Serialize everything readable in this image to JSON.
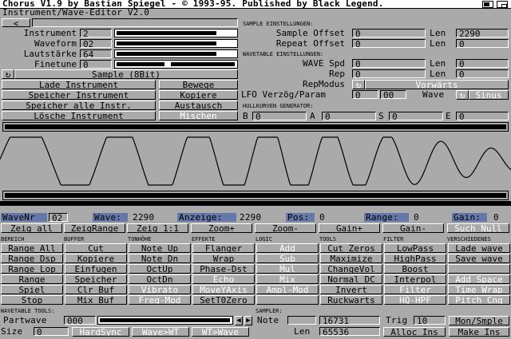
{
  "title": "Chorus V1.9 by Bastian Spiegel - © 1993-95. Published by Black Legend.",
  "editor_title": "Instrument/Wave-Editor V2.0",
  "top_left_btn": "<",
  "instrument_params": [
    {
      "label": "Instrument",
      "value": "2",
      "level": 0.98
    },
    {
      "label": "Waveform",
      "value": "02",
      "level": 0.98
    },
    {
      "label": "Lautstärke",
      "value": "64",
      "level": 0.98
    },
    {
      "label": "Finetune",
      "value": "0",
      "level": 0.48
    }
  ],
  "sample_btn": "Sample (8Bit)",
  "instr_buttons": [
    {
      "left": "Lade Instrument",
      "right": "Bewege"
    },
    {
      "left": "Speicher Instrument",
      "right": "Kopiere"
    },
    {
      "left": "Speicher alle Instr.",
      "right": "Austausch"
    },
    {
      "left": "Lösche Instrument",
      "right": "Mischen"
    }
  ],
  "sample_settings": {
    "header": "SAMPLE EINSTELLUNGEN:",
    "rows": [
      {
        "label": "Sample Offset",
        "value": "0",
        "len_label": "Len",
        "len": "2290"
      },
      {
        "label": "Repeat Offset",
        "value": "0",
        "len_label": "Len",
        "len": "0"
      }
    ]
  },
  "wavetable_settings": {
    "header": "WAVETABLE EINSTELLUNGEN:",
    "rows": [
      {
        "label": "WAVE Spd",
        "value": "0",
        "len_label": "Len",
        "len": "0"
      },
      {
        "label": "Rep",
        "value": "0",
        "len_label": "Len",
        "len": "0"
      }
    ],
    "repmodus_label": "RepModus",
    "repmodus_value": "Vorwärts",
    "lfo_label": "LFO Verzög/Param",
    "lfo_value": "0",
    "lfo_param": "00",
    "wave_label": "Wave",
    "wave_value": "Sinus"
  },
  "envelope": {
    "header": "HULLKURVEN GENERATOR:",
    "fields": [
      {
        "label": "B",
        "value": "0"
      },
      {
        "label": "A",
        "value": "0"
      },
      {
        "label": "S",
        "value": "0"
      },
      {
        "label": "E",
        "value": "0"
      }
    ]
  },
  "status": {
    "wavenr_label": "WaveNr",
    "wavenr": "02",
    "wave_label": "Wave:",
    "wave": "2290",
    "anzeige_label": "Anzeige:",
    "anzeige": "2290",
    "pos_label": "Pos:",
    "pos": "0",
    "range_label": "Range:",
    "range": "0",
    "gain_label": "Gain:",
    "gain": "0"
  },
  "zoom_row": [
    "Zeig all",
    "ZeigRange",
    "Zeig 1:1",
    "Zoom+",
    "Zoom-",
    "Gain+",
    "Gain-",
    "Such Null"
  ],
  "section_headers": [
    "BEREICH",
    "BUFFER",
    "TONHÖHE",
    "EFFEKTE",
    "LOGIC",
    "TOOLS",
    "FILTER",
    "VERSCHIEDENES"
  ],
  "grid": [
    [
      "Range All",
      "Cut",
      "Note Up",
      "Flanger",
      "Add",
      "Cut Zeros",
      "LowPass",
      "Lade wave"
    ],
    [
      "Range Dsp",
      "Kopiere",
      "Note Dn",
      "Wrap",
      "Sub",
      "Maximize",
      "HighPass",
      "Save wave"
    ],
    [
      "Range Lop",
      "Einfugen",
      "OctUp",
      "Phase-Dst",
      "Mul",
      "ChangeVol",
      "Boost",
      ""
    ],
    [
      "Range",
      "Speicher",
      "OctDn",
      "Echo",
      "Mix",
      "Normal DC",
      "Interpol",
      "Add Space"
    ],
    [
      "Spiel",
      "Clr Buf",
      "Vibrato",
      "MoveYAxis",
      "Ampl-Mod",
      "Invert",
      "Filter",
      "Time Wrap"
    ],
    [
      "Stop",
      "Mix Buf",
      "Freq-Mod",
      "SetT0Zero",
      "",
      "Ruckwarts",
      "HQ-HPF",
      "Pitch Cng"
    ]
  ],
  "wavetable_tools": {
    "header": "WAVETABLE TOOLS:",
    "partwave_label": "Partwave",
    "partwave": "000",
    "size_label": "Size",
    "size": "0",
    "buttons": [
      "HardSync",
      "Wave>WT",
      "WT>Wave"
    ]
  },
  "sampler": {
    "header": "SAMPLER:",
    "note_label": "Note",
    "note": "",
    "freq": "16731",
    "trig_label": "Trig",
    "trig": "10",
    "monsmple": "Mon/Smple",
    "len_label": "Len",
    "len": "65536",
    "alloc": "Alloc Ins",
    "make": "Make Ins"
  }
}
